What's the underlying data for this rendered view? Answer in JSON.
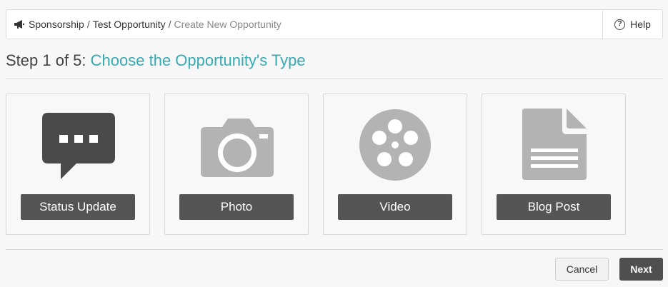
{
  "breadcrumb": {
    "icon": "megaphone-icon",
    "items": [
      "Sponsorship",
      "Test Opportunity"
    ],
    "separator": "/",
    "current": "Create New Opportunity"
  },
  "help": {
    "label": "Help",
    "icon": "question-circle-icon"
  },
  "step": {
    "prefix": "Step 1 of 5:",
    "title": "Choose the Opportunity's Type"
  },
  "types": [
    {
      "label": "Status Update",
      "icon": "chat-bubble-icon",
      "icon_color": "#4a4a4a"
    },
    {
      "label": "Photo",
      "icon": "camera-icon",
      "icon_color": "#b3b3b3"
    },
    {
      "label": "Video",
      "icon": "film-reel-icon",
      "icon_color": "#b3b3b3"
    },
    {
      "label": "Blog Post",
      "icon": "document-icon",
      "icon_color": "#b3b3b3"
    }
  ],
  "footer": {
    "cancel_label": "Cancel",
    "next_label": "Next"
  },
  "colors": {
    "accent": "#37aab2",
    "button_dark": "#555555"
  }
}
